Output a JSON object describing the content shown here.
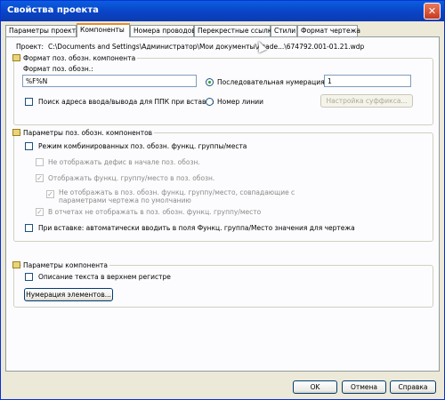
{
  "window": {
    "title": "Свойства проекта",
    "close_glyph": "✕"
  },
  "tabs": [
    {
      "label": "Параметры проекта"
    },
    {
      "label": "Компоненты"
    },
    {
      "label": "Номера проводов"
    },
    {
      "label": "Перекрестные ссылки"
    },
    {
      "label": "Стили"
    },
    {
      "label": "Формат чертежа"
    }
  ],
  "project": {
    "label": "Проект:",
    "path": "C:\\Documents and Settings\\Администратор\\Мои документы\\Acade...\\674792.001-01.21.wdp"
  },
  "tag_format": {
    "group_title": "Формат поз. обозн. компонента",
    "format_label": "Формат поз. обозн.:",
    "format_value": "%F%N",
    "search_ppk_label": "Поиск адреса ввода/вывода для ППК при вставке",
    "search_ppk_checked": false,
    "sequential_label": "Последовательная нумерация:",
    "sequential_selected": true,
    "sequential_value": "1",
    "line_number_label": "Номер линии",
    "suffix_button": "Настройка суффикса..."
  },
  "tag_params": {
    "group_title": "Параметры поз. обозн. компонентов",
    "combined_mode_label": "Режим комбинированных поз. обозн. функц. группы/места",
    "no_hyphen_label": "Не отображать дефис в начале поз. обозн.",
    "show_func_label": "Отображать функц. группу/место в поз. обозн.",
    "hide_matching_label": "Не отображать в поз. обозн. функц. группу/место, совпадающие с параметрами чертежа по умолчанию",
    "reports_label": "В отчетах не отображать в поз. обозн. функц. группу/место",
    "auto_insert_label": "При вставке: автоматически вводить в поля Функц. группа/Место значения для чертежа"
  },
  "component_params": {
    "group_title": "Параметры компонента",
    "uppercase_label": "Описание текста в верхнем регистре",
    "numbering_button": "Нумерация элементов..."
  },
  "footer": {
    "ok": "OK",
    "cancel": "Отмена",
    "help": "Справка"
  }
}
